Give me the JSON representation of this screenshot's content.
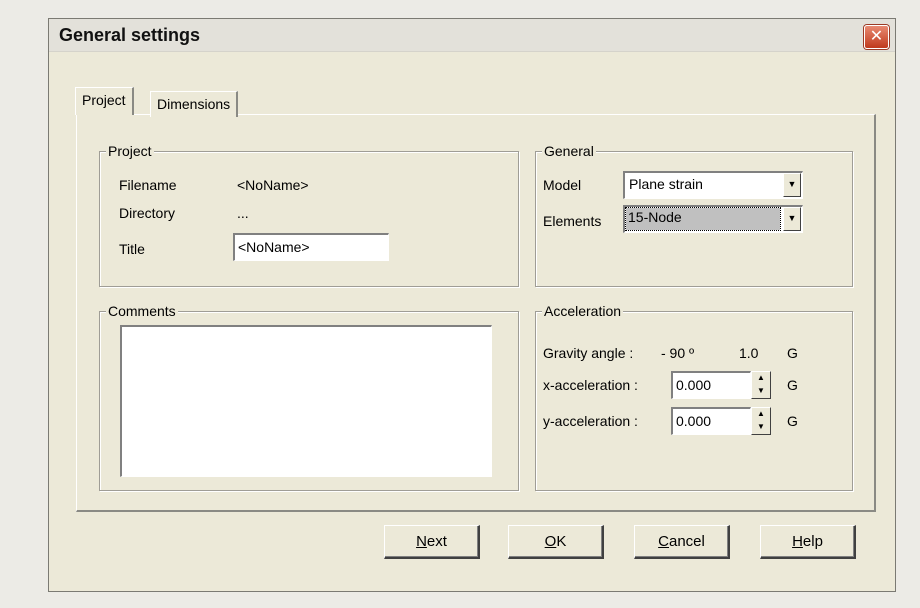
{
  "window": {
    "title": "General settings",
    "close_label": "✕"
  },
  "tabs": [
    {
      "label": "Project",
      "selected": true
    },
    {
      "label": "Dimensions",
      "selected": false
    }
  ],
  "project_group": {
    "legend": "Project",
    "filename_label": "Filename",
    "filename_value": "<NoName>",
    "directory_label": "Directory",
    "directory_value": "...",
    "title_label": "Title",
    "title_value": "<NoName>"
  },
  "comments_group": {
    "legend": "Comments",
    "value": ""
  },
  "general_group": {
    "legend": "General",
    "model_label": "Model",
    "model_value": "Plane strain",
    "elements_label": "Elements",
    "elements_value": "15-Node"
  },
  "acceleration_group": {
    "legend": "Acceleration",
    "gravity_label": "Gravity angle :",
    "gravity_angle": "- 90 º",
    "gravity_value": "1.0",
    "gravity_unit": "G",
    "x_label": "x-acceleration :",
    "x_value": "0.000",
    "x_unit": "G",
    "y_label": "y-acceleration :",
    "y_value": "0.000",
    "y_unit": "G"
  },
  "buttons": {
    "next_mnemonic": "N",
    "next_rest": "ext",
    "ok_mnemonic": "O",
    "ok_rest": "K",
    "cancel_mnemonic": "C",
    "cancel_rest": "ancel",
    "help_mnemonic": "H",
    "help_rest": "elp"
  }
}
